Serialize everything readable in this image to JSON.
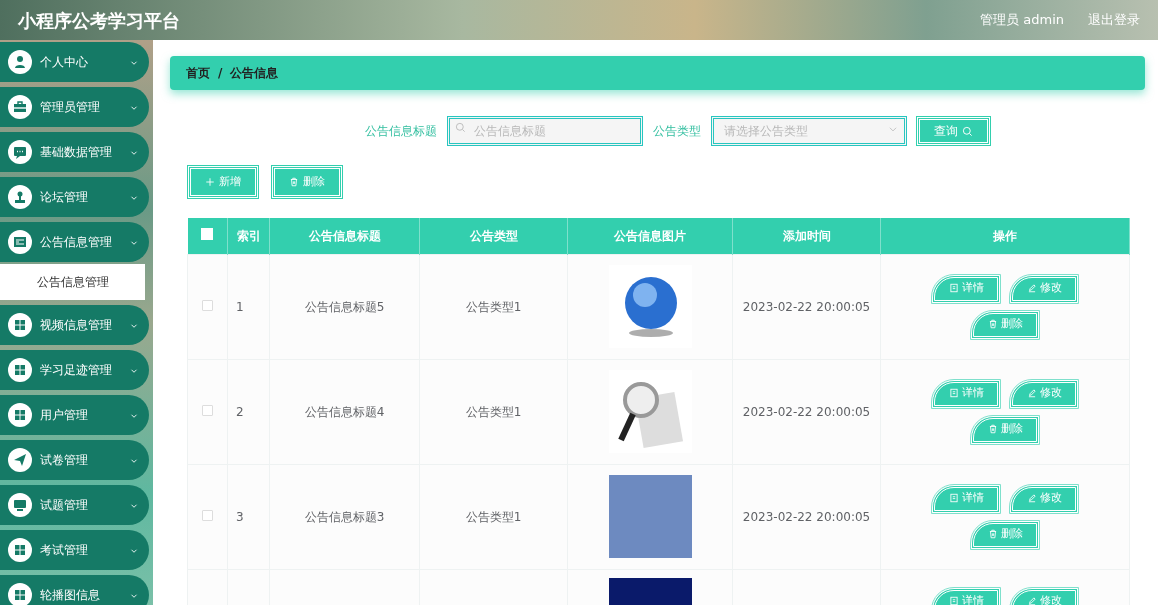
{
  "header": {
    "title": "小程序公考学习平台",
    "user": "管理员 admin",
    "logout": "退出登录"
  },
  "sidebar": {
    "items": [
      {
        "label": "个人中心"
      },
      {
        "label": "管理员管理"
      },
      {
        "label": "基础数据管理"
      },
      {
        "label": "论坛管理"
      },
      {
        "label": "公告信息管理",
        "children": [
          {
            "label": "公告信息管理",
            "selected": true
          }
        ]
      },
      {
        "label": "视频信息管理"
      },
      {
        "label": "学习足迹管理"
      },
      {
        "label": "用户管理"
      },
      {
        "label": "试卷管理"
      },
      {
        "label": "试题管理"
      },
      {
        "label": "考试管理"
      },
      {
        "label": "轮播图信息"
      }
    ]
  },
  "breadcrumb": {
    "items": [
      "首页",
      "公告信息"
    ],
    "separator": "/"
  },
  "search": {
    "title_label": "公告信息标题",
    "title_placeholder": "公告信息标题",
    "type_label": "公告类型",
    "type_placeholder": "请选择公告类型",
    "button": "查询"
  },
  "actions": [
    "新增",
    "删除"
  ],
  "table": {
    "select_all": {
      "checked": false
    },
    "columns": [
      "索引",
      "公告信息标题",
      "公告类型",
      "公告信息图片",
      "添加时间",
      "操作"
    ],
    "rows": [
      {
        "checked": false,
        "index": "1",
        "title": "公告信息标题5",
        "type": "公告类型1",
        "time": "2023-02-22 20:00:05",
        "buttons": [
          "详情",
          "修改",
          "删除"
        ]
      },
      {
        "checked": false,
        "index": "2",
        "title": "公告信息标题4",
        "type": "公告类型1",
        "time": "2023-02-22 20:00:05",
        "buttons": [
          "详情",
          "修改",
          "删除"
        ]
      },
      {
        "checked": false,
        "index": "3",
        "title": "公告信息标题3",
        "type": "公告类型1",
        "time": "2023-02-22 20:00:05",
        "buttons": [
          "详情",
          "修改",
          "删除"
        ]
      },
      {
        "buttons": [
          "详情",
          "修改"
        ]
      }
    ]
  }
}
